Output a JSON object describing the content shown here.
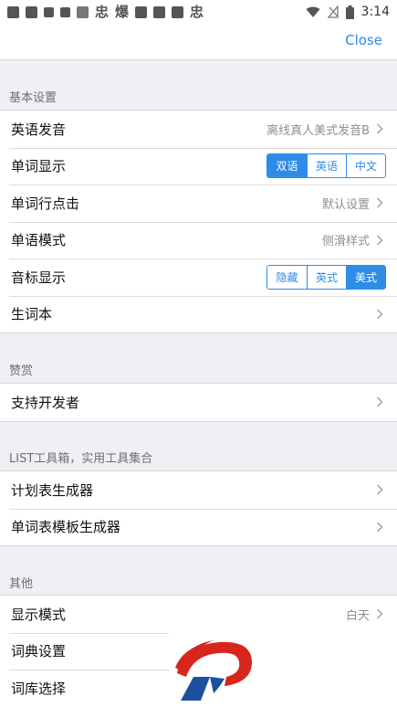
{
  "status_bar": {
    "time": "3:14",
    "left_icons": [
      "notification-icon",
      "app-icon",
      "app-icon",
      "app-icon",
      "news-icon",
      "app-icon",
      "app-icon",
      "app-icon",
      "app-icon",
      "app-icon",
      "app-icon"
    ],
    "text_glyphs": [
      "忠",
      "爆",
      "忠"
    ]
  },
  "navbar": {
    "close_label": "Close"
  },
  "sections": {
    "basic": {
      "title": "基本设置",
      "rows": [
        {
          "label": "英语发音",
          "value": "离线真人美式发音B"
        },
        {
          "label": "单词显示",
          "segments": [
            "双语",
            "英语",
            "中文"
          ],
          "selected": "双语"
        },
        {
          "label": "单词行点击",
          "value": "默认设置"
        },
        {
          "label": "单语模式",
          "value": "侧滑样式"
        },
        {
          "label": "音标显示",
          "segments": [
            "隐藏",
            "英式",
            "美式"
          ],
          "selected": "美式"
        },
        {
          "label": "生词本",
          "value": ""
        }
      ]
    },
    "appreciate": {
      "title": "赞赏",
      "rows": [
        {
          "label": "支持开发者",
          "value": ""
        }
      ]
    },
    "tools": {
      "title": "LIST工具箱，实用工具集合",
      "rows": [
        {
          "label": "计划表生成器",
          "value": ""
        },
        {
          "label": "单词表模板生成器",
          "value": ""
        }
      ]
    },
    "other": {
      "title": "其他",
      "rows": [
        {
          "label": "显示模式",
          "value": "白天"
        },
        {
          "label": "词典设置",
          "value": ""
        },
        {
          "label": "词库选择",
          "value": ""
        }
      ]
    }
  },
  "colors": {
    "accent": "#2e8be6",
    "background": "#efeff4",
    "logo_red": "#d7261c",
    "logo_blue": "#1c4fa0"
  }
}
